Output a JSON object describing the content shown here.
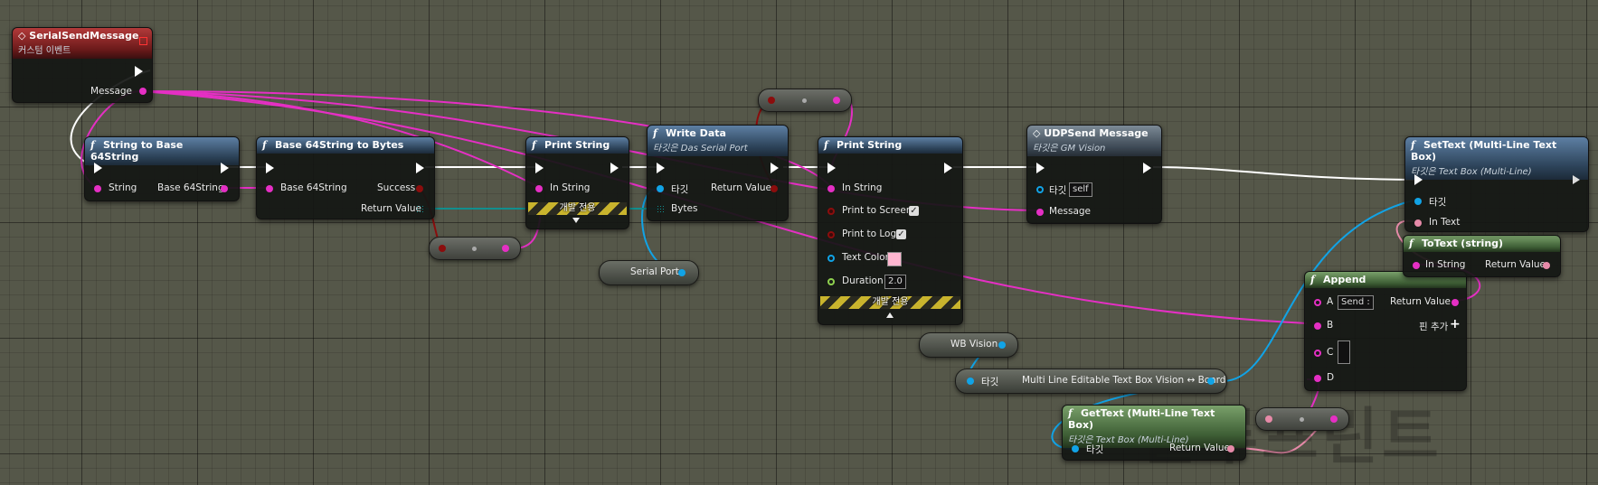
{
  "watermark": "블루프린트",
  "nodes": {
    "serial_send_message": {
      "title": "SerialSendMessage",
      "subtitle": "커스텀 이벤트",
      "pin_message": "Message"
    },
    "string_to_base64": {
      "title": "String to Base 64String",
      "pin_in": "String",
      "pin_out": "Base 64String"
    },
    "base64_to_bytes": {
      "title": "Base 64String to Bytes",
      "pin_in": "Base 64String",
      "pin_success": "Success",
      "pin_return": "Return Value"
    },
    "print_string_1": {
      "title": "Print String",
      "pin_in": "In String",
      "dev_only": "개발 전용"
    },
    "write_data": {
      "title": "Write Data",
      "subtitle": "타깃은 Das Serial Port",
      "pin_target": "타깃",
      "pin_bytes": "Bytes",
      "pin_return": "Return Value"
    },
    "print_string_2": {
      "title": "Print String",
      "pin_in": "In String",
      "pin_screen": "Print to Screen",
      "pin_log": "Print to Log",
      "pin_color": "Text Color",
      "pin_duration": "Duration",
      "duration_value": "2.0",
      "dev_only": "개발 전용"
    },
    "udp_send": {
      "title": "UDPSend Message",
      "subtitle": "타깃은 GM Vision",
      "pin_target": "타깃",
      "target_value": "self",
      "pin_message": "Message"
    },
    "set_text": {
      "title": "SetText (Multi-Line Text Box)",
      "subtitle": "타깃은 Text Box (Multi-Line)",
      "pin_target": "타깃",
      "pin_in": "In Text"
    },
    "to_text": {
      "title": "ToText (string)",
      "pin_in": "In String",
      "pin_out": "Return Value"
    },
    "append": {
      "title": "Append",
      "pin_a": "A",
      "a_value": "Send :",
      "pin_b": "B",
      "pin_c": "C",
      "pin_d": "D",
      "pin_out": "Return Value",
      "add_pin": "핀 추가"
    },
    "get_text": {
      "title": "GetText (Multi-Line Text Box)",
      "subtitle": "타깃은 Text Box (Multi-Line)",
      "pin_target": "타깃",
      "pin_out": "Return Value"
    }
  },
  "variables": {
    "serial_port": "Serial Port",
    "wb_vision": "WB Vision",
    "board_target": "타깃",
    "board": "Multi Line Editable Text Box Vision ↔ Board"
  },
  "colors": {
    "exec": "#ffffff",
    "string": "#e52fc4",
    "object": "#11a3e6",
    "bool": "#8b0d0d",
    "bytes": "#118e8e",
    "text": "#e68aa8",
    "float": "#8fd14f",
    "text_color_swatch": "#ffb6d0"
  }
}
